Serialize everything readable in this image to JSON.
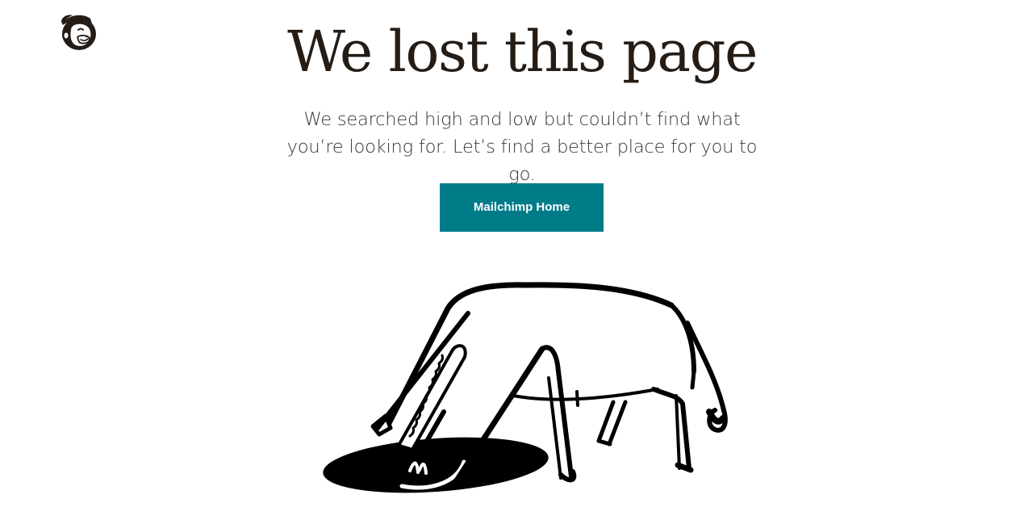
{
  "header": {
    "logo_icon": "mailchimp-freddie-logo"
  },
  "main": {
    "title": "We lost this page",
    "message": "We searched high and low but couldn’t find what you’re looking for. Let’s find a better place for you to go.",
    "home_button_label": "Mailchimp Home",
    "illustration_icon": "horse-head-in-hole-illustration"
  },
  "colors": {
    "button_bg": "#007c89",
    "button_text": "#ffffff",
    "text": "#241c15",
    "background": "#ffffff"
  }
}
